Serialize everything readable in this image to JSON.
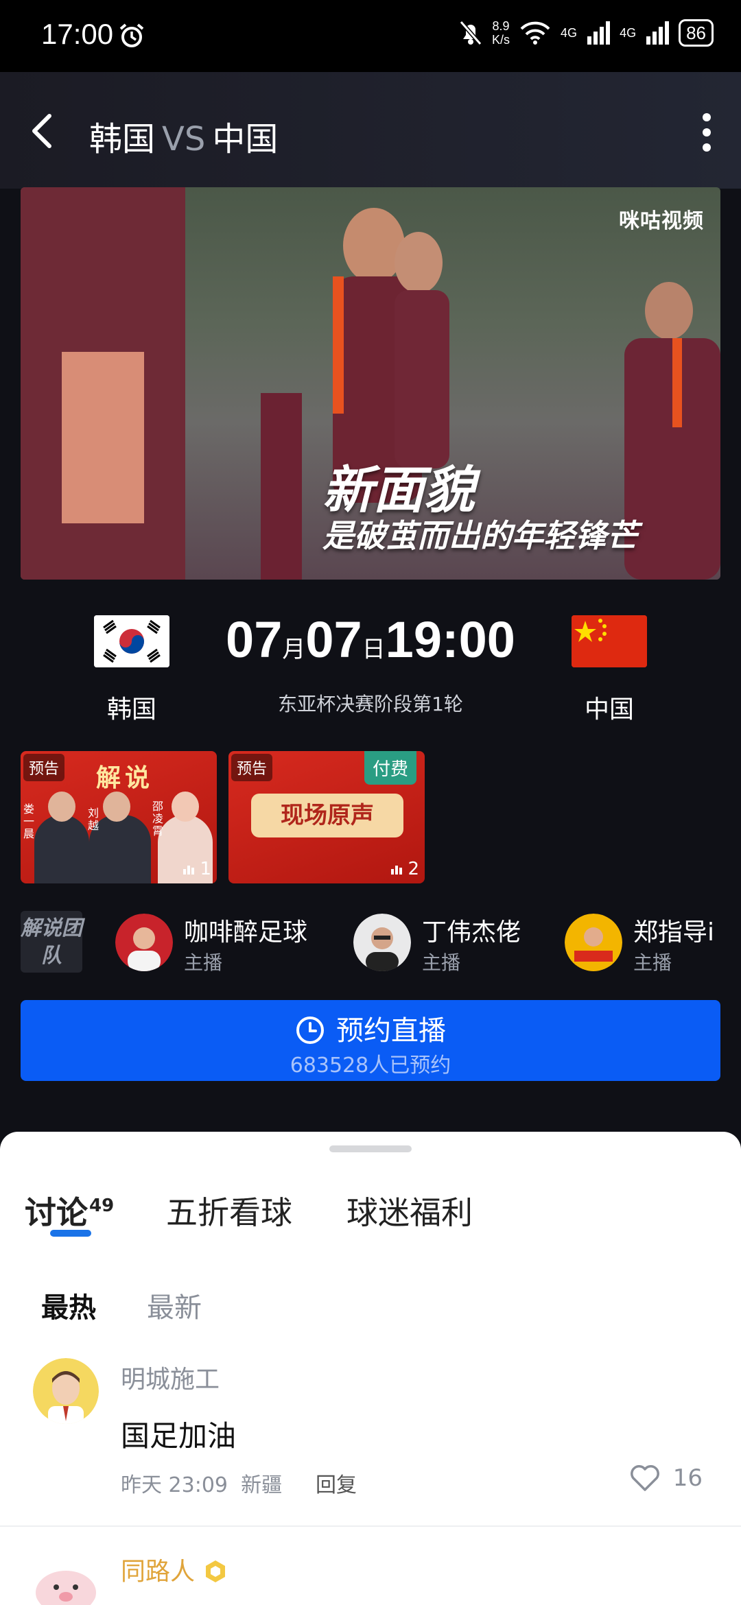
{
  "status_bar": {
    "time": "17:00",
    "speed_value": "8.9",
    "speed_unit": "K/s",
    "signal1": "4G",
    "signal2": "4G",
    "battery": "86"
  },
  "header": {
    "home_team": "韩国",
    "vs": "VS",
    "away_team": "中国"
  },
  "video": {
    "logo_text": "咪咕视频",
    "caption_line1": "新面貌",
    "caption_line2": "是破茧而出的年轻锋芒"
  },
  "match": {
    "month": "07",
    "month_unit": "月",
    "day": "07",
    "day_unit": "日",
    "time": "19:00",
    "round": "东亚杯决赛阶段第1轮",
    "home_name": "韩国",
    "away_name": "中国"
  },
  "cards": [
    {
      "tag": "预告",
      "title": "解说",
      "count": "1",
      "names": [
        "娄一晨",
        "刘越",
        "邵凌霄"
      ]
    },
    {
      "tag": "预告",
      "paid": "付费",
      "badge": "现场原声",
      "count": "2"
    }
  ],
  "commentators": {
    "label": "解说团队",
    "items": [
      {
        "name": "咖啡醉足球",
        "role": "主播"
      },
      {
        "name": "丁伟杰佬",
        "role": "主播"
      },
      {
        "name": "郑指导i",
        "role": "主播"
      }
    ]
  },
  "reserve": {
    "label": "预约直播",
    "count_text": "683528人已预约"
  },
  "sheet": {
    "tabs": [
      {
        "label": "讨论",
        "count": "49"
      },
      {
        "label": "五折看球"
      },
      {
        "label": "球迷福利"
      }
    ],
    "sort_hot": "最热",
    "sort_new": "最新",
    "comments": [
      {
        "user": "明城施工",
        "text": "国足加油",
        "time": "昨天 23:09",
        "location": "新疆",
        "reply": "回复",
        "likes": "16"
      },
      {
        "user": "同路人"
      }
    ]
  },
  "colors": {
    "accent": "#0a5cf5",
    "tab_underline": "#1a73e8",
    "card_red": "#d72a1f",
    "paid_green": "#2a9d83"
  }
}
